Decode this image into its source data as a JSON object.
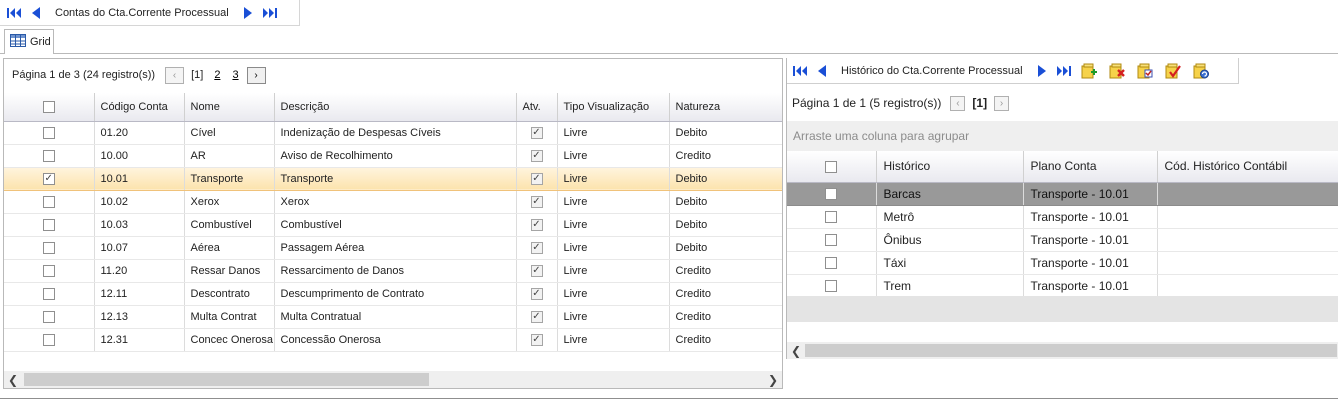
{
  "top_nav": {
    "title": "Contas do Cta.Corrente Processual",
    "icons": [
      "first-page-icon",
      "prev-page-icon",
      "next-page-icon",
      "last-page-icon"
    ]
  },
  "tabs": [
    {
      "label": "Grid",
      "icon": "grid-icon"
    }
  ],
  "left": {
    "pager": {
      "summary": "Página 1 de 3 (24 registro(s))",
      "current": "[1]",
      "pages": [
        "2",
        "3"
      ],
      "prev_symbol": "‹",
      "next_symbol": "›"
    },
    "columns": [
      "Código Conta",
      "Nome",
      "Descrição",
      "Atv.",
      "Tipo Visualização",
      "Natureza"
    ],
    "rows": [
      {
        "checked": false,
        "codigo": "01.20",
        "nome": "Cível",
        "descricao": "Indenização de Despesas Cíveis",
        "ativo": true,
        "tipo": "Livre",
        "natureza": "Debito"
      },
      {
        "checked": false,
        "codigo": "10.00",
        "nome": "AR",
        "descricao": "Aviso de Recolhimento",
        "ativo": true,
        "tipo": "Livre",
        "natureza": "Credito"
      },
      {
        "checked": true,
        "codigo": "10.01",
        "nome": "Transporte",
        "descricao": "Transporte",
        "ativo": true,
        "tipo": "Livre",
        "natureza": "Debito",
        "selected": true
      },
      {
        "checked": false,
        "codigo": "10.02",
        "nome": "Xerox",
        "descricao": "Xerox",
        "ativo": true,
        "tipo": "Livre",
        "natureza": "Debito"
      },
      {
        "checked": false,
        "codigo": "10.03",
        "nome": "Combustível",
        "descricao": "Combustível",
        "ativo": true,
        "tipo": "Livre",
        "natureza": "Debito"
      },
      {
        "checked": false,
        "codigo": "10.07",
        "nome": "Aérea",
        "descricao": "Passagem Aérea",
        "ativo": true,
        "tipo": "Livre",
        "natureza": "Debito"
      },
      {
        "checked": false,
        "codigo": "11.20",
        "nome": "Ressar Danos",
        "descricao": "Ressarcimento de Danos",
        "ativo": true,
        "tipo": "Livre",
        "natureza": "Credito"
      },
      {
        "checked": false,
        "codigo": "12.11",
        "nome": "Descontrato",
        "descricao": "Descumprimento de Contrato",
        "ativo": true,
        "tipo": "Livre",
        "natureza": "Credito"
      },
      {
        "checked": false,
        "codigo": "12.13",
        "nome": "Multa Contrat",
        "descricao": "Multa Contratual",
        "ativo": true,
        "tipo": "Livre",
        "natureza": "Credito"
      },
      {
        "checked": false,
        "codigo": "12.31",
        "nome": "Concec Onerosa",
        "descricao": "Concessão Onerosa",
        "ativo": true,
        "tipo": "Livre",
        "natureza": "Credito"
      }
    ]
  },
  "right": {
    "toolbar": {
      "title": "Histórico do Cta.Corrente Processual",
      "icons": [
        "first-page-icon",
        "prev-page-icon",
        "next-page-icon",
        "last-page-icon",
        "add-record-icon",
        "delete-record-icon",
        "edit-record-icon",
        "confirm-record-icon",
        "refresh-record-icon"
      ]
    },
    "pager": {
      "summary": "Página 1 de 1 (5 registro(s))",
      "current": "[1]",
      "prev_symbol": "‹",
      "next_symbol": "›"
    },
    "group_hint": "Arraste uma coluna para agrupar",
    "columns": [
      "Histórico",
      "Plano Conta",
      "Cód. Histórico Contábil"
    ],
    "rows": [
      {
        "historico": "Barcas",
        "plano": "Transporte - 10.01",
        "cod": "",
        "selected": true
      },
      {
        "historico": "Metrô",
        "plano": "Transporte - 10.01",
        "cod": ""
      },
      {
        "historico": "Ônibus",
        "plano": "Transporte - 10.01",
        "cod": ""
      },
      {
        "historico": "Táxi",
        "plano": "Transporte - 10.01",
        "cod": ""
      },
      {
        "historico": "Trem",
        "plano": "Transporte - 10.01",
        "cod": ""
      }
    ]
  },
  "colors": {
    "nav_blue": "#1a4fd6",
    "selected_row": "#fce3ad",
    "right_selected_row": "#999999"
  }
}
